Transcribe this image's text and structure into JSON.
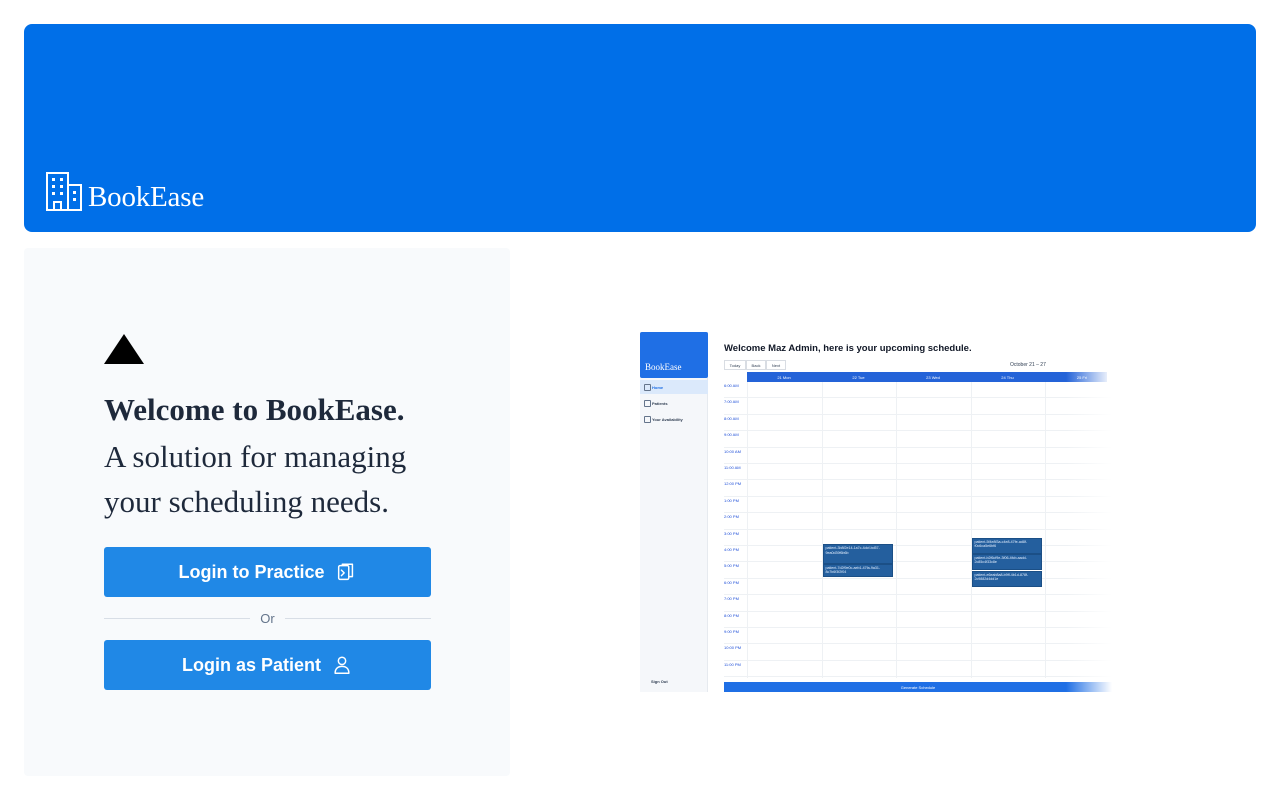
{
  "hero": {
    "brand_name": "BookEase",
    "background_color": "#006fe8",
    "brand_icon": "building-icon"
  },
  "login": {
    "logo_icon": "triangle-icon",
    "welcome": "Welcome to BookEase.",
    "tagline": "A solution for managing your scheduling needs.",
    "practice_button_label": "Login to Practice",
    "practice_button_icon": "clipboard-copy-icon",
    "divider_label": "Or",
    "patient_button_label": "Login as Patient",
    "patient_button_icon": "user-icon",
    "button_color": "#2088e6"
  },
  "preview": {
    "brand_name": "BookEase",
    "nav_items": [
      "Home",
      "Patients",
      "Your Availability"
    ],
    "sign_out_label": "Sign Out",
    "title": "Welcome Maz Admin, here is your upcoming schedule.",
    "toolbar": [
      "Today",
      "Back",
      "Next"
    ],
    "date_range": "October 21 – 27",
    "day_headers": [
      "21 Mon",
      "22 Tue",
      "23 Wed",
      "24 Thu",
      "25 Fri"
    ],
    "time_slots": [
      "6:00 AM",
      "7:00 AM",
      "8:00 AM",
      "9:00 AM",
      "10:00 AM",
      "11:00 AM",
      "12:00 PM",
      "1:00 PM",
      "2:00 PM",
      "3:00 PM",
      "4:00 PM",
      "5:00 PM",
      "6:00 PM",
      "7:00 PM",
      "8:00 PM",
      "9:00 PM",
      "10:00 PM",
      "11:00 PM"
    ],
    "events": [
      {
        "text": "patient-3b8f2e14-1a7c-4dcf-bd57-9ea0d39f6b6b"
      },
      {
        "text": "patient-7d2f9e0c-aeb1-47fa-9a31-8c7b6f3f2f04"
      },
      {
        "text": "patient-5f4e8f3a-c4e8-47fe-ad8f-f0c6ca5e6bf6"
      },
      {
        "text": "patient-b2f6cf9e-3f06-4fcb-aadd-2c85c4f33c8e"
      },
      {
        "text": "patient-e6eab8a8-b9ff-4b1d-878f-2c9882d4dd1e"
      }
    ],
    "footer_label": "Generate Schedule"
  }
}
